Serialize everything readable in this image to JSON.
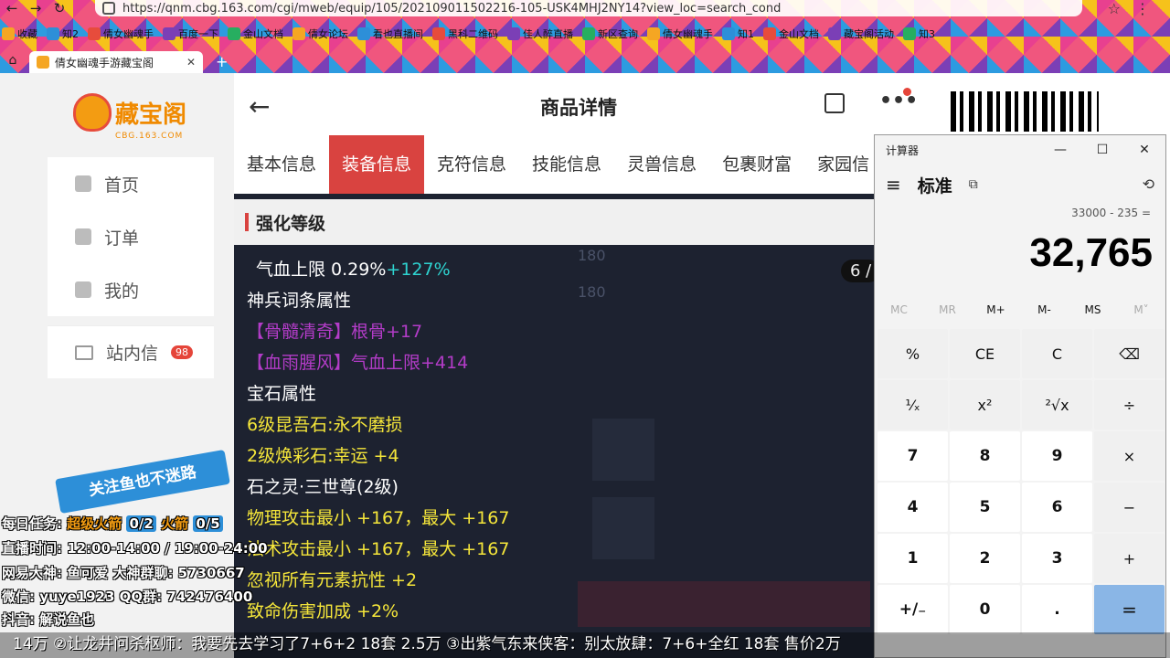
{
  "browser": {
    "url": "https://qnm.cbg.163.com/cgi/mweb/equip/105/202109011502216-105-USK4MHJ2NY14?view_loc=search_cond",
    "bookmarks": [
      "收藏",
      "知2",
      "倩女幽魂手",
      "百度一下",
      "金山文档",
      "倩女论坛",
      "看也直播间",
      "黑科二维码",
      "佳人醉直播",
      "新区查询",
      "倩女幽魂手",
      "知1",
      "金山文档",
      "藏宝阁活动",
      "知3"
    ],
    "tab_title": "倩女幽魂手游藏宝阁",
    "colors": {
      "bookmark_icons": [
        "#f5a623",
        "#2d8fd8",
        "#e74c3c",
        "#7b3fb6",
        "#27ae60"
      ]
    }
  },
  "site": {
    "logo_text": "藏宝阁",
    "logo_sub": "CBG.163.COM",
    "nav": [
      {
        "label": "首页"
      },
      {
        "label": "订单"
      },
      {
        "label": "我的"
      }
    ],
    "messages": {
      "label": "站内信",
      "count": "98"
    }
  },
  "product": {
    "title": "商品详情",
    "tabs": [
      "基本信息",
      "装备信息",
      "克符信息",
      "技能信息",
      "灵兽信息",
      "包裹财富",
      "家园信"
    ],
    "active_tab": 1,
    "section_title": "强化等级",
    "bg_values": [
      "180",
      "180"
    ],
    "page_indicator": "6 /",
    "attributes": [
      {
        "parts": [
          {
            "t": "气血上限 0.29%",
            "c": ""
          },
          {
            "t": "+127%",
            "c": "c-cyan"
          }
        ],
        "indent": true
      },
      {
        "parts": [
          {
            "t": "神兵词条属性",
            "c": ""
          }
        ]
      },
      {
        "parts": [
          {
            "t": "【骨髓清奇】根骨+17",
            "c": "c-purple"
          }
        ]
      },
      {
        "parts": [
          {
            "t": "【血雨腥风】气血上限+414",
            "c": "c-purple"
          }
        ]
      },
      {
        "parts": [
          {
            "t": "宝石属性",
            "c": ""
          }
        ]
      },
      {
        "parts": [
          {
            "t": "6级昆吾石:永不磨损",
            "c": "c-yellow"
          }
        ]
      },
      {
        "parts": [
          {
            "t": "2级焕彩石:幸运 +4",
            "c": "c-yellow"
          }
        ]
      },
      {
        "parts": [
          {
            "t": "石之灵·三世尊(2级)",
            "c": ""
          }
        ]
      },
      {
        "parts": [
          {
            "t": "物理攻击最小 +167，最大 +167",
            "c": "c-yellow"
          }
        ]
      },
      {
        "parts": [
          {
            "t": "法术攻击最小 +167，最大 +167",
            "c": "c-yellow"
          }
        ]
      },
      {
        "parts": [
          {
            "t": "忽视所有元素抗性 +2",
            "c": "c-yellow"
          }
        ]
      },
      {
        "parts": [
          {
            "t": "致命伤害加成 +2%",
            "c": "c-yellow"
          }
        ]
      }
    ],
    "colors": {
      "active_tab": "#d94340",
      "cyan": "#2ed3d0",
      "purple": "#b33cc8",
      "yellow": "#f5e63a"
    }
  },
  "calculator": {
    "window_title": "计算器",
    "mode": "标准",
    "expression": "33000 - 235 =",
    "result": "32,765",
    "memory": [
      "MC",
      "MR",
      "M+",
      "M-",
      "MS",
      "M˅"
    ],
    "memory_disabled": [
      true,
      true,
      false,
      false,
      false,
      true
    ],
    "keys": [
      "%",
      "CE",
      "C",
      "⌫",
      "¹⁄ₓ",
      "x²",
      "²√x",
      "÷",
      "7",
      "8",
      "9",
      "×",
      "4",
      "5",
      "6",
      "−",
      "1",
      "2",
      "3",
      "+",
      "+/₋",
      "0",
      ".",
      "="
    ],
    "key_types": [
      "fn",
      "fn",
      "fn",
      "fn",
      "fn",
      "fn",
      "fn",
      "fn",
      "num",
      "num",
      "num",
      "fn",
      "num",
      "num",
      "num",
      "fn",
      "num",
      "num",
      "num",
      "fn",
      "num",
      "num",
      "num",
      "eq"
    ]
  },
  "overlay": {
    "banner": "关注鱼也不迷路",
    "daily_label": "每日任务:",
    "task1": "超级火箭",
    "task1_count": "0/2",
    "task2": "火箭",
    "task2_count": "0/5",
    "schedule": "直播时间: 12:00-14:00 / 19:00-24:00",
    "line3": "网易大神: 鱼可爱   大神群聊: 5730667",
    "line4": "微信: yuye1923   QQ群: 742476400",
    "line5": "抖音: 解说鱼也",
    "ticker": "14万   ②让龙井问杀枢师：我要先去学习了7+6+2 18套 2.5万     ③出紫气东来侠客：别太放肆：7+6+全红 18套 售价2万"
  }
}
